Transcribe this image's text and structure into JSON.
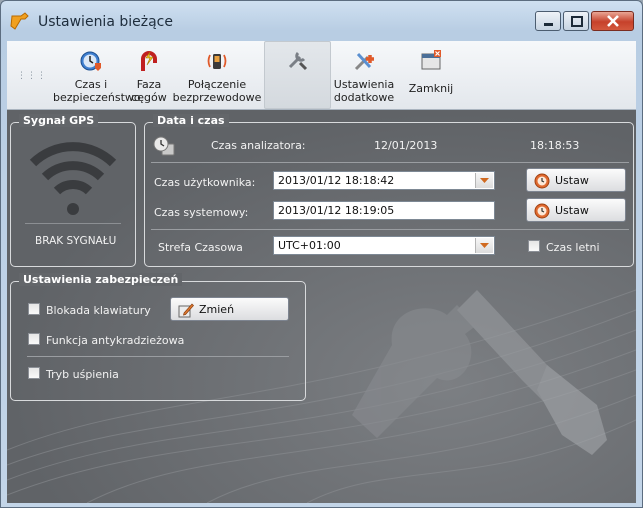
{
  "window": {
    "title": "Ustawienia bieżące",
    "buttons": [
      "minimize-icon",
      "maximize-icon",
      "close-icon"
    ]
  },
  "toolbar": {
    "items": [
      {
        "label_line1": "Czas i",
        "label_line2": "bezpieczeństwo",
        "icon": "clock-shield-icon"
      },
      {
        "label_line1": "Faza",
        "label_line2": "cęgów",
        "icon": "clamp-phase-icon"
      },
      {
        "label_line1": "Połączenie",
        "label_line2": "bezprzewodowe",
        "icon": "wireless-phone-icon"
      },
      {
        "label_line1": "",
        "label_line2": "",
        "icon": "wrench-tools-icon"
      },
      {
        "label_line1": "Ustawienia",
        "label_line2": "dodatkowe",
        "icon": "additional-settings-icon"
      },
      {
        "label_line1": "Zamknij",
        "label_line2": "",
        "icon": "close-window-icon"
      }
    ]
  },
  "gps": {
    "title": "Sygnał GPS",
    "status": "BRAK SYGNAŁU",
    "icon": "wifi-signal-icon"
  },
  "datetime": {
    "title": "Data i czas",
    "analyzer_label": "Czas analizatora:",
    "analyzer_date": "12/01/2013",
    "analyzer_time": "18:18:53",
    "user_label": "Czas użytkownika:",
    "user_value": "2013/01/12 18:18:42",
    "system_label": "Czas systemowy:",
    "system_value": "2013/01/12 18:19:05",
    "set_label": "Ustaw",
    "timezone_label": "Strefa Czasowa",
    "timezone_value": "UTC+01:00",
    "dst_label": "Czas letni"
  },
  "security": {
    "title": "Ustawienia zabezpieczeń",
    "keyboard_lock": "Blokada klawiatury",
    "change_label": "Zmień",
    "antitheft": "Funkcja antykradzieżowa",
    "sleep_mode": "Tryb uśpienia"
  },
  "colors": {
    "accent": "#e05a2a",
    "content_bg": "#65686c",
    "title_bg": "#c3d5e8"
  }
}
